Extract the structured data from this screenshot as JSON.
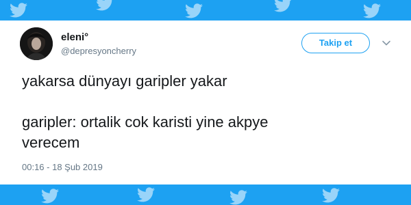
{
  "user": {
    "display_name": "eleni°",
    "handle": "@depresyoncherry"
  },
  "follow_button": {
    "label": "Takip et"
  },
  "tweet": {
    "lines": [
      "yakarsa dünyayı garipler yakar",
      "garipler: ortalik cok karisti yine akpye",
      "verecem"
    ],
    "timestamp": "00:16 - 18 Şub 2019"
  },
  "icons": {
    "bird": "twitter-bird-icon",
    "caret": "chevron-down-icon"
  },
  "colors": {
    "brand": "#1da1f2",
    "text": "#14171a",
    "muted": "#657786",
    "background": "#ffffff"
  }
}
